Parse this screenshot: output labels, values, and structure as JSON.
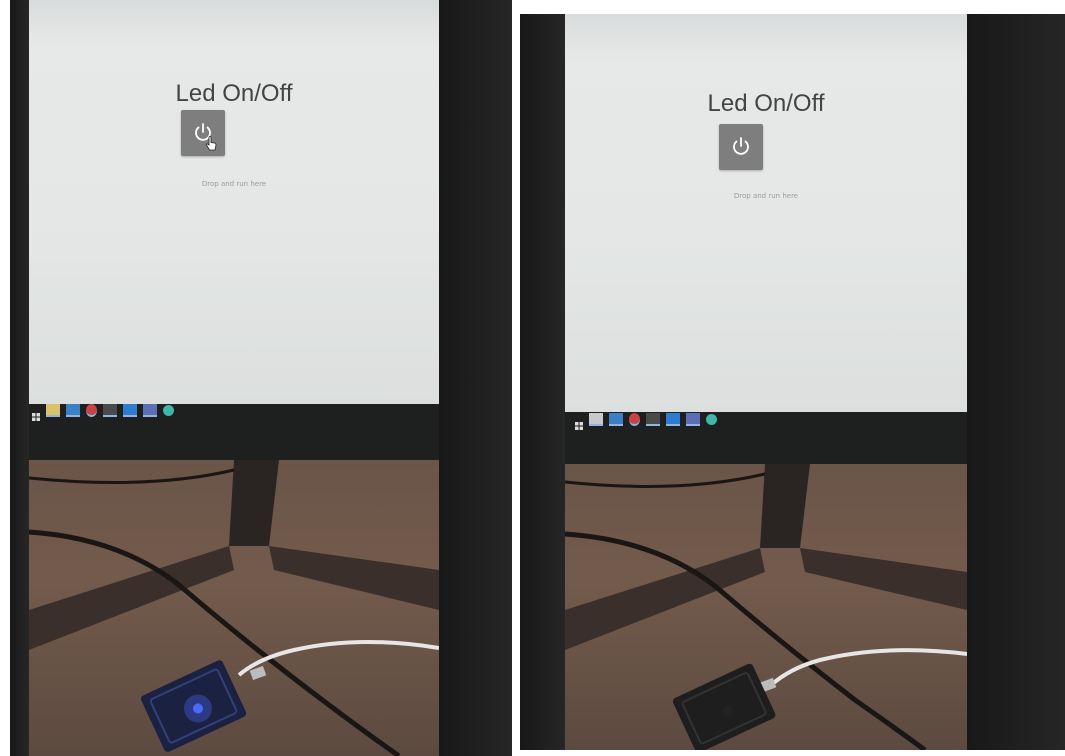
{
  "frames": [
    {
      "id": "left",
      "app_title": "Led On/Off",
      "drop_hint": "Drop and run here",
      "led_on": true,
      "colors": {
        "led": "#4a6bff",
        "board": "#1b2140"
      }
    },
    {
      "id": "right",
      "app_title": "Led On/Off",
      "drop_hint": "Drop and run here",
      "led_on": false,
      "colors": {
        "led": "#222222",
        "board": "#1e1e1e"
      }
    }
  ],
  "icons": {
    "power": "power-icon",
    "cursor": "hand-cursor-icon"
  }
}
